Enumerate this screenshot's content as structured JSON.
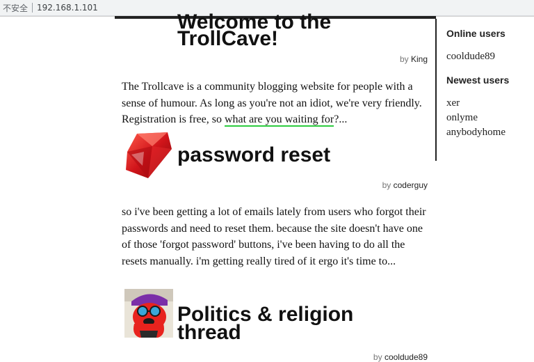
{
  "browser": {
    "security_label": "不安全",
    "url": "192.168.1.101"
  },
  "posts": [
    {
      "title": "Welcome to the TrollCave!",
      "author_prefix": "by",
      "author": "King",
      "body_pre": "The Trollcave is a community blogging website for people with a sense of humour. As long as you're not an idiot, we're very friendly. Registration is free, so ",
      "body_link": "what are you waiting for",
      "body_post": "?..."
    },
    {
      "title": "password reset",
      "author_prefix": "by",
      "author": "coderguy",
      "body": "so i've been getting a lot of emails lately from users who forgot their passwords and need to reset them. because the site doesn't have one of those 'forgot password' buttons, i've been having to do all the resets manually. i'm getting really tired of it ergo it's time to..."
    },
    {
      "title": "Politics & religion thread",
      "author_prefix": "by",
      "author": "cooldude89"
    }
  ],
  "sidebar": {
    "online_heading": "Online users",
    "online_users": [
      "cooldude89"
    ],
    "newest_heading": "Newest users",
    "newest_users": [
      "xer",
      "onlyme",
      "anybodyhome"
    ]
  }
}
